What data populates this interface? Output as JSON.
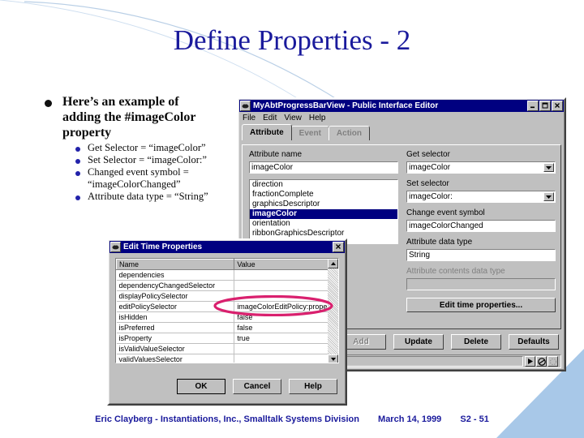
{
  "slide": {
    "title": "Define Properties - 2",
    "accent_color": "#1a1a9c",
    "decor_color": "#aec7e8"
  },
  "bullets": {
    "main": "Here’s an example of adding the #imageColor property",
    "sub": [
      "Get Selector = “imageColor”",
      "Set Selector = “imageColor:”",
      "Changed event symbol = “imageColorChanged”",
      "Attribute data type = “String”"
    ]
  },
  "editor_window": {
    "title": "MyAbtProgressBarView - Public Interface Editor",
    "icon": "app-icon",
    "window_buttons": {
      "minimize": "_",
      "maximize": "□",
      "close": "✕"
    },
    "menus": [
      "File",
      "Edit",
      "View",
      "Help"
    ],
    "tabs": [
      {
        "label": "Attribute",
        "active": true
      },
      {
        "label": "Event",
        "active": false
      },
      {
        "label": "Action",
        "active": false
      }
    ],
    "attribute_name_label": "Attribute name",
    "attribute_name_value": "imageColor",
    "attribute_list": [
      "direction",
      "fractionComplete",
      "graphicsDescriptor",
      "imageColor",
      "orientation",
      "ribbonGraphicsDescriptor"
    ],
    "attribute_list_selected": "imageColor",
    "get_selector_label": "Get selector",
    "get_selector_value": "imageColor",
    "set_selector_label": "Set selector",
    "set_selector_value": "imageColor:",
    "change_event_label": "Change event symbol",
    "change_event_value": "imageColorChanged",
    "data_type_label": "Attribute data type",
    "data_type_value": "String",
    "contents_type_label": "Attribute contents data type",
    "contents_type_value": "",
    "edit_time_button": "Edit time properties...",
    "action_buttons": [
      {
        "label": "Add",
        "enabled": false
      },
      {
        "label": "Update",
        "enabled": true
      },
      {
        "label": "Delete",
        "enabled": true
      },
      {
        "label": "Defaults",
        "enabled": true
      }
    ],
    "status_text": ""
  },
  "edit_time_dialog": {
    "title": "Edit Time Properties",
    "icon": "app-icon",
    "close_button": "✕",
    "columns": [
      "Name",
      "Value"
    ],
    "rows": [
      {
        "name": "dependencies",
        "value": ""
      },
      {
        "name": "dependencyChangedSelector",
        "value": ""
      },
      {
        "name": "displayPolicySelector",
        "value": ""
      },
      {
        "name": "editPolicySelector",
        "value": "imageColorEditPolicy:property,Data",
        "highlighted": true
      },
      {
        "name": "isHidden",
        "value": "false"
      },
      {
        "name": "isPreferred",
        "value": "false"
      },
      {
        "name": "isProperty",
        "value": "true"
      },
      {
        "name": "isValidValueSelector",
        "value": ""
      },
      {
        "name": "validValuesSelector",
        "value": ""
      }
    ],
    "buttons": [
      {
        "label": "OK",
        "default": true
      },
      {
        "label": "Cancel",
        "default": false
      },
      {
        "label": "Help",
        "default": false
      }
    ],
    "annotation_color": "#d9206e"
  },
  "footer": {
    "author": "Eric Clayberg - Instantiations, Inc., Smalltalk Systems Division",
    "date": "March 14, 1999",
    "slide_number": "S2 - 51"
  }
}
